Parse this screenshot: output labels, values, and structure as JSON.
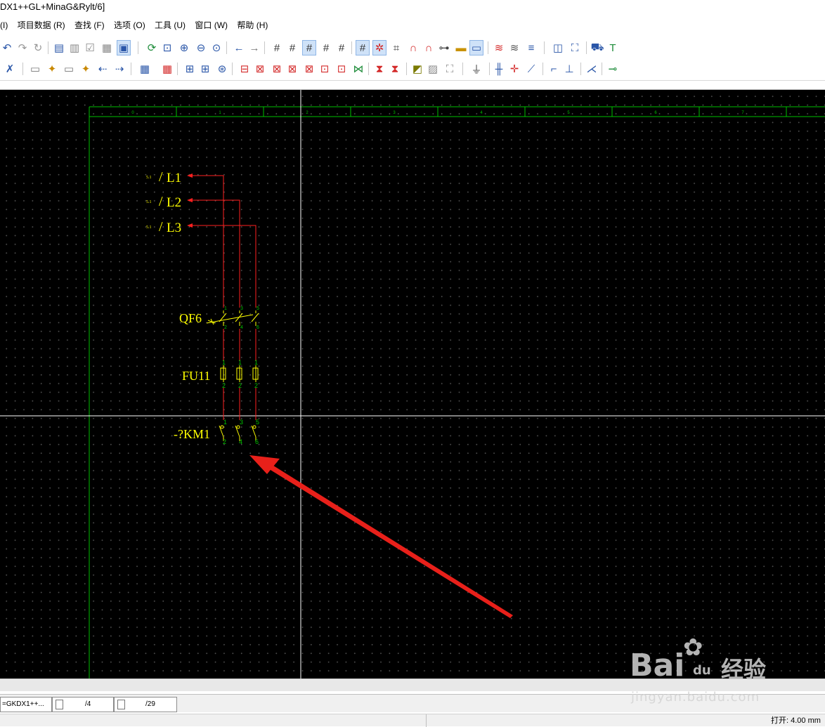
{
  "title": "DX1++GL+MinaG&Rylt/6]",
  "menu": [
    "(I)",
    "项目数据 (R)",
    "查找 (F)",
    "选项 (O)",
    "工具 (U)",
    "窗口 (W)",
    "帮助 (H)"
  ],
  "drawing": {
    "column_numbers": [
      "0",
      "1",
      "2",
      "3",
      "4",
      "5",
      "6",
      "7"
    ],
    "lines": [
      {
        "ref": "5.1",
        "label": "L1"
      },
      {
        "ref": "5.1",
        "label": "L2"
      },
      {
        "ref": "5.1",
        "label": "L3"
      }
    ],
    "breaker": {
      "tag": "QF6",
      "terminals_top": [
        "1",
        "3",
        "5"
      ],
      "terminals_bottom": [
        "2",
        "4",
        "6"
      ]
    },
    "fuse": {
      "tag": "FU11",
      "terminals_top": [
        "1",
        "1",
        "1"
      ],
      "terminals_bottom": [
        "2",
        "2",
        "2"
      ]
    },
    "contactor": {
      "tag": "-?KM1",
      "terminals_top": [
        "1",
        "3",
        "5"
      ],
      "terminals_bottom": [
        "2",
        "4",
        "6"
      ]
    },
    "colors": {
      "background": "#000000",
      "frame": "#00c000",
      "wire": "#ff2020",
      "symbol": "#ffff00",
      "crosshair": "#ffffff",
      "annotation_arrow": "#e8201a"
    }
  },
  "tabs": [
    {
      "label": "=GKDX1++..."
    },
    {
      "label": "/4"
    },
    {
      "label": "/29"
    }
  ],
  "status": {
    "coordinate": "打开: 4.00 mm"
  },
  "watermark": {
    "brand": "Bai",
    "brand_du": "du",
    "cn": "经验",
    "url": "jingyan.baidu.com"
  }
}
